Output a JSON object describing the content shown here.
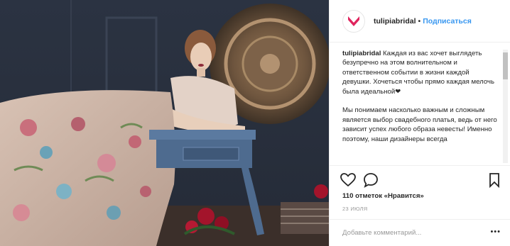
{
  "post": {
    "username": "tulipiabridal",
    "separator": "•",
    "follow_label": "Подписаться",
    "caption_user": "tulipiabridal",
    "caption_text": " Каждая из вас хочет выглядеть безупречно на этом волнительном и ответственном событии в жизни каждой девушки. Хочеться чтобы прямо каждая мелочь была идеальной❤\n\nМы понимаем насколько важным и сложным является выбор свадебного платья, ведь от него зависит успех любого образа невесты! Именно поэтому, наши дизайнеры всегда",
    "likes_text": "110 отметок «Нравится»",
    "date_text": "23 ИЮЛЯ",
    "comment_placeholder": "Добавьте комментарий...",
    "more_label": "•••"
  },
  "icons": [
    "heart-icon",
    "comment-icon",
    "bookmark-icon",
    "brand-logo-icon"
  ],
  "colors": {
    "accent": "#3897f0",
    "brand": "#e0245e",
    "border": "#efefef",
    "muted": "#999999"
  }
}
